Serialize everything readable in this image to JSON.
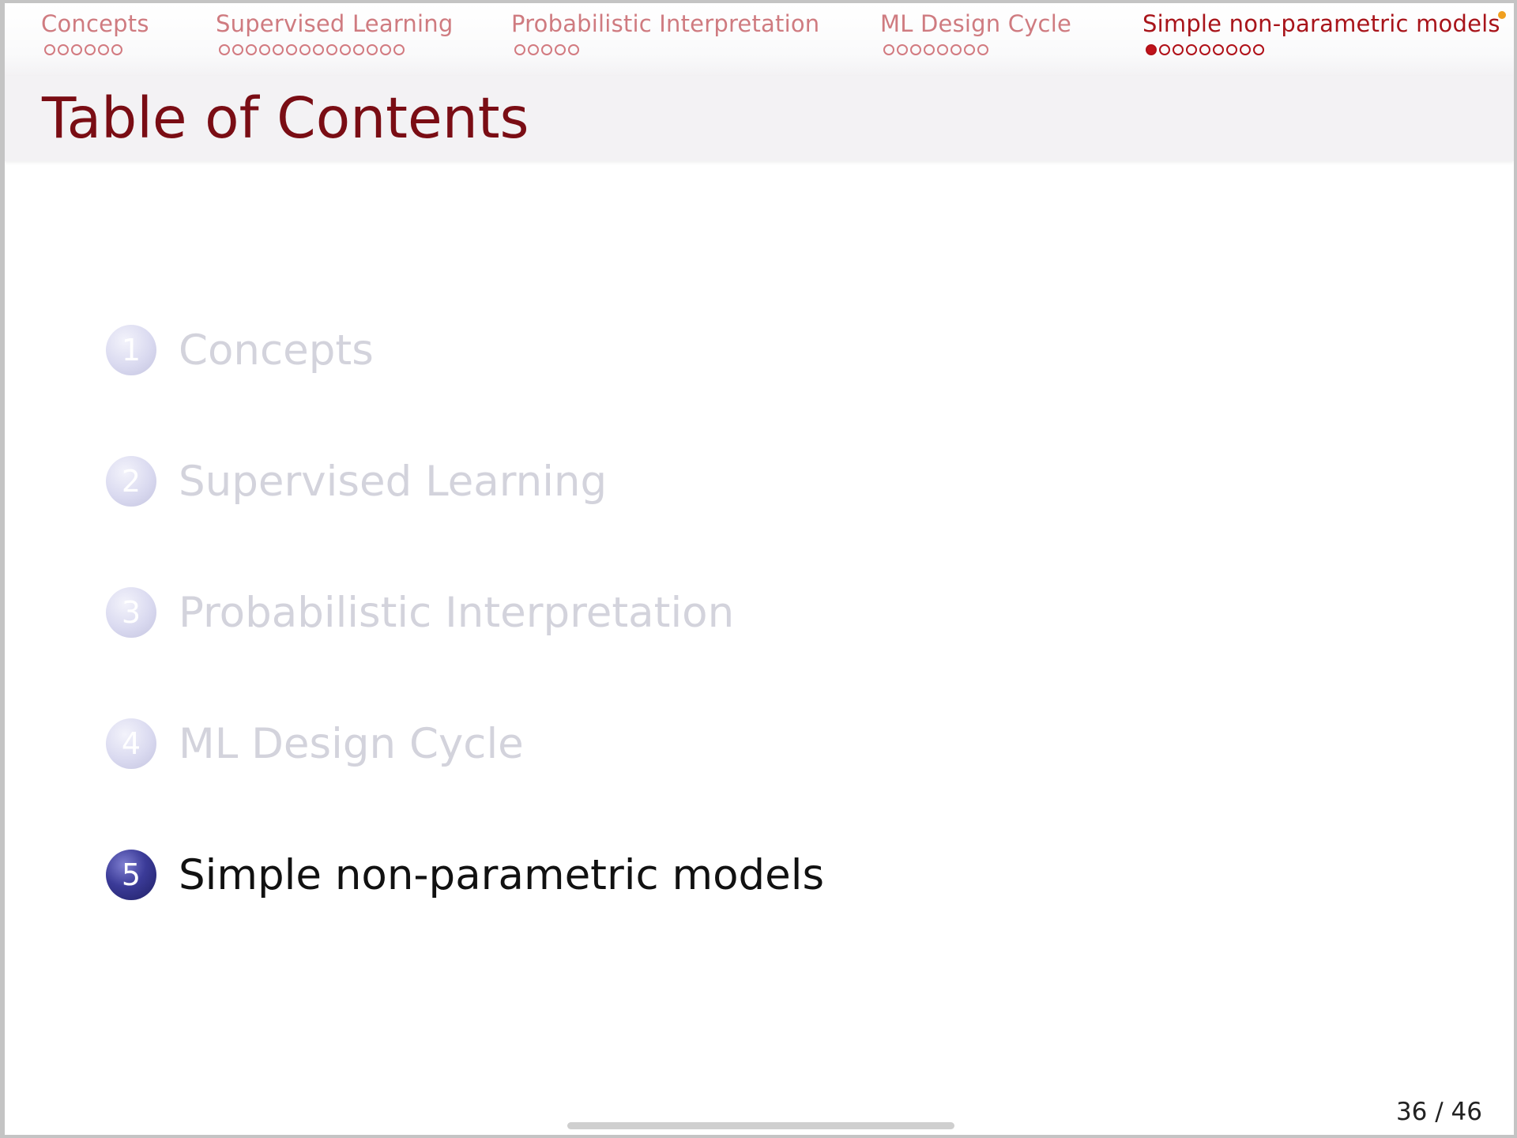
{
  "nav": {
    "sections": [
      {
        "title": "Concepts",
        "dots": 6,
        "filled": 0,
        "active": false
      },
      {
        "title": "Supervised Learning",
        "dots": 14,
        "filled": 0,
        "active": false
      },
      {
        "title": "Probabilistic Interpretation",
        "dots": 5,
        "filled": 0,
        "active": false
      },
      {
        "title": "ML Design Cycle",
        "dots": 8,
        "filled": 0,
        "active": false
      },
      {
        "title": "Simple non-parametric models",
        "dots": 9,
        "filled": 1,
        "active": true
      }
    ]
  },
  "frame": {
    "title": "Table of Contents"
  },
  "toc": {
    "items": [
      {
        "number": "1",
        "label": "Concepts",
        "current": false
      },
      {
        "number": "2",
        "label": "Supervised Learning",
        "current": false
      },
      {
        "number": "3",
        "label": "Probabilistic Interpretation",
        "current": false
      },
      {
        "number": "4",
        "label": "ML Design Cycle",
        "current": false
      },
      {
        "number": "5",
        "label": "Simple non-parametric models",
        "current": true
      }
    ]
  },
  "footer": {
    "page_number": "36 / 46"
  },
  "colors": {
    "nav_inactive": "#cf7b80",
    "nav_active": "#a8141a",
    "title": "#7a0d14",
    "toc_current_ball": "#2b2b7a",
    "toc_inactive_text": "#d3d3dc"
  }
}
